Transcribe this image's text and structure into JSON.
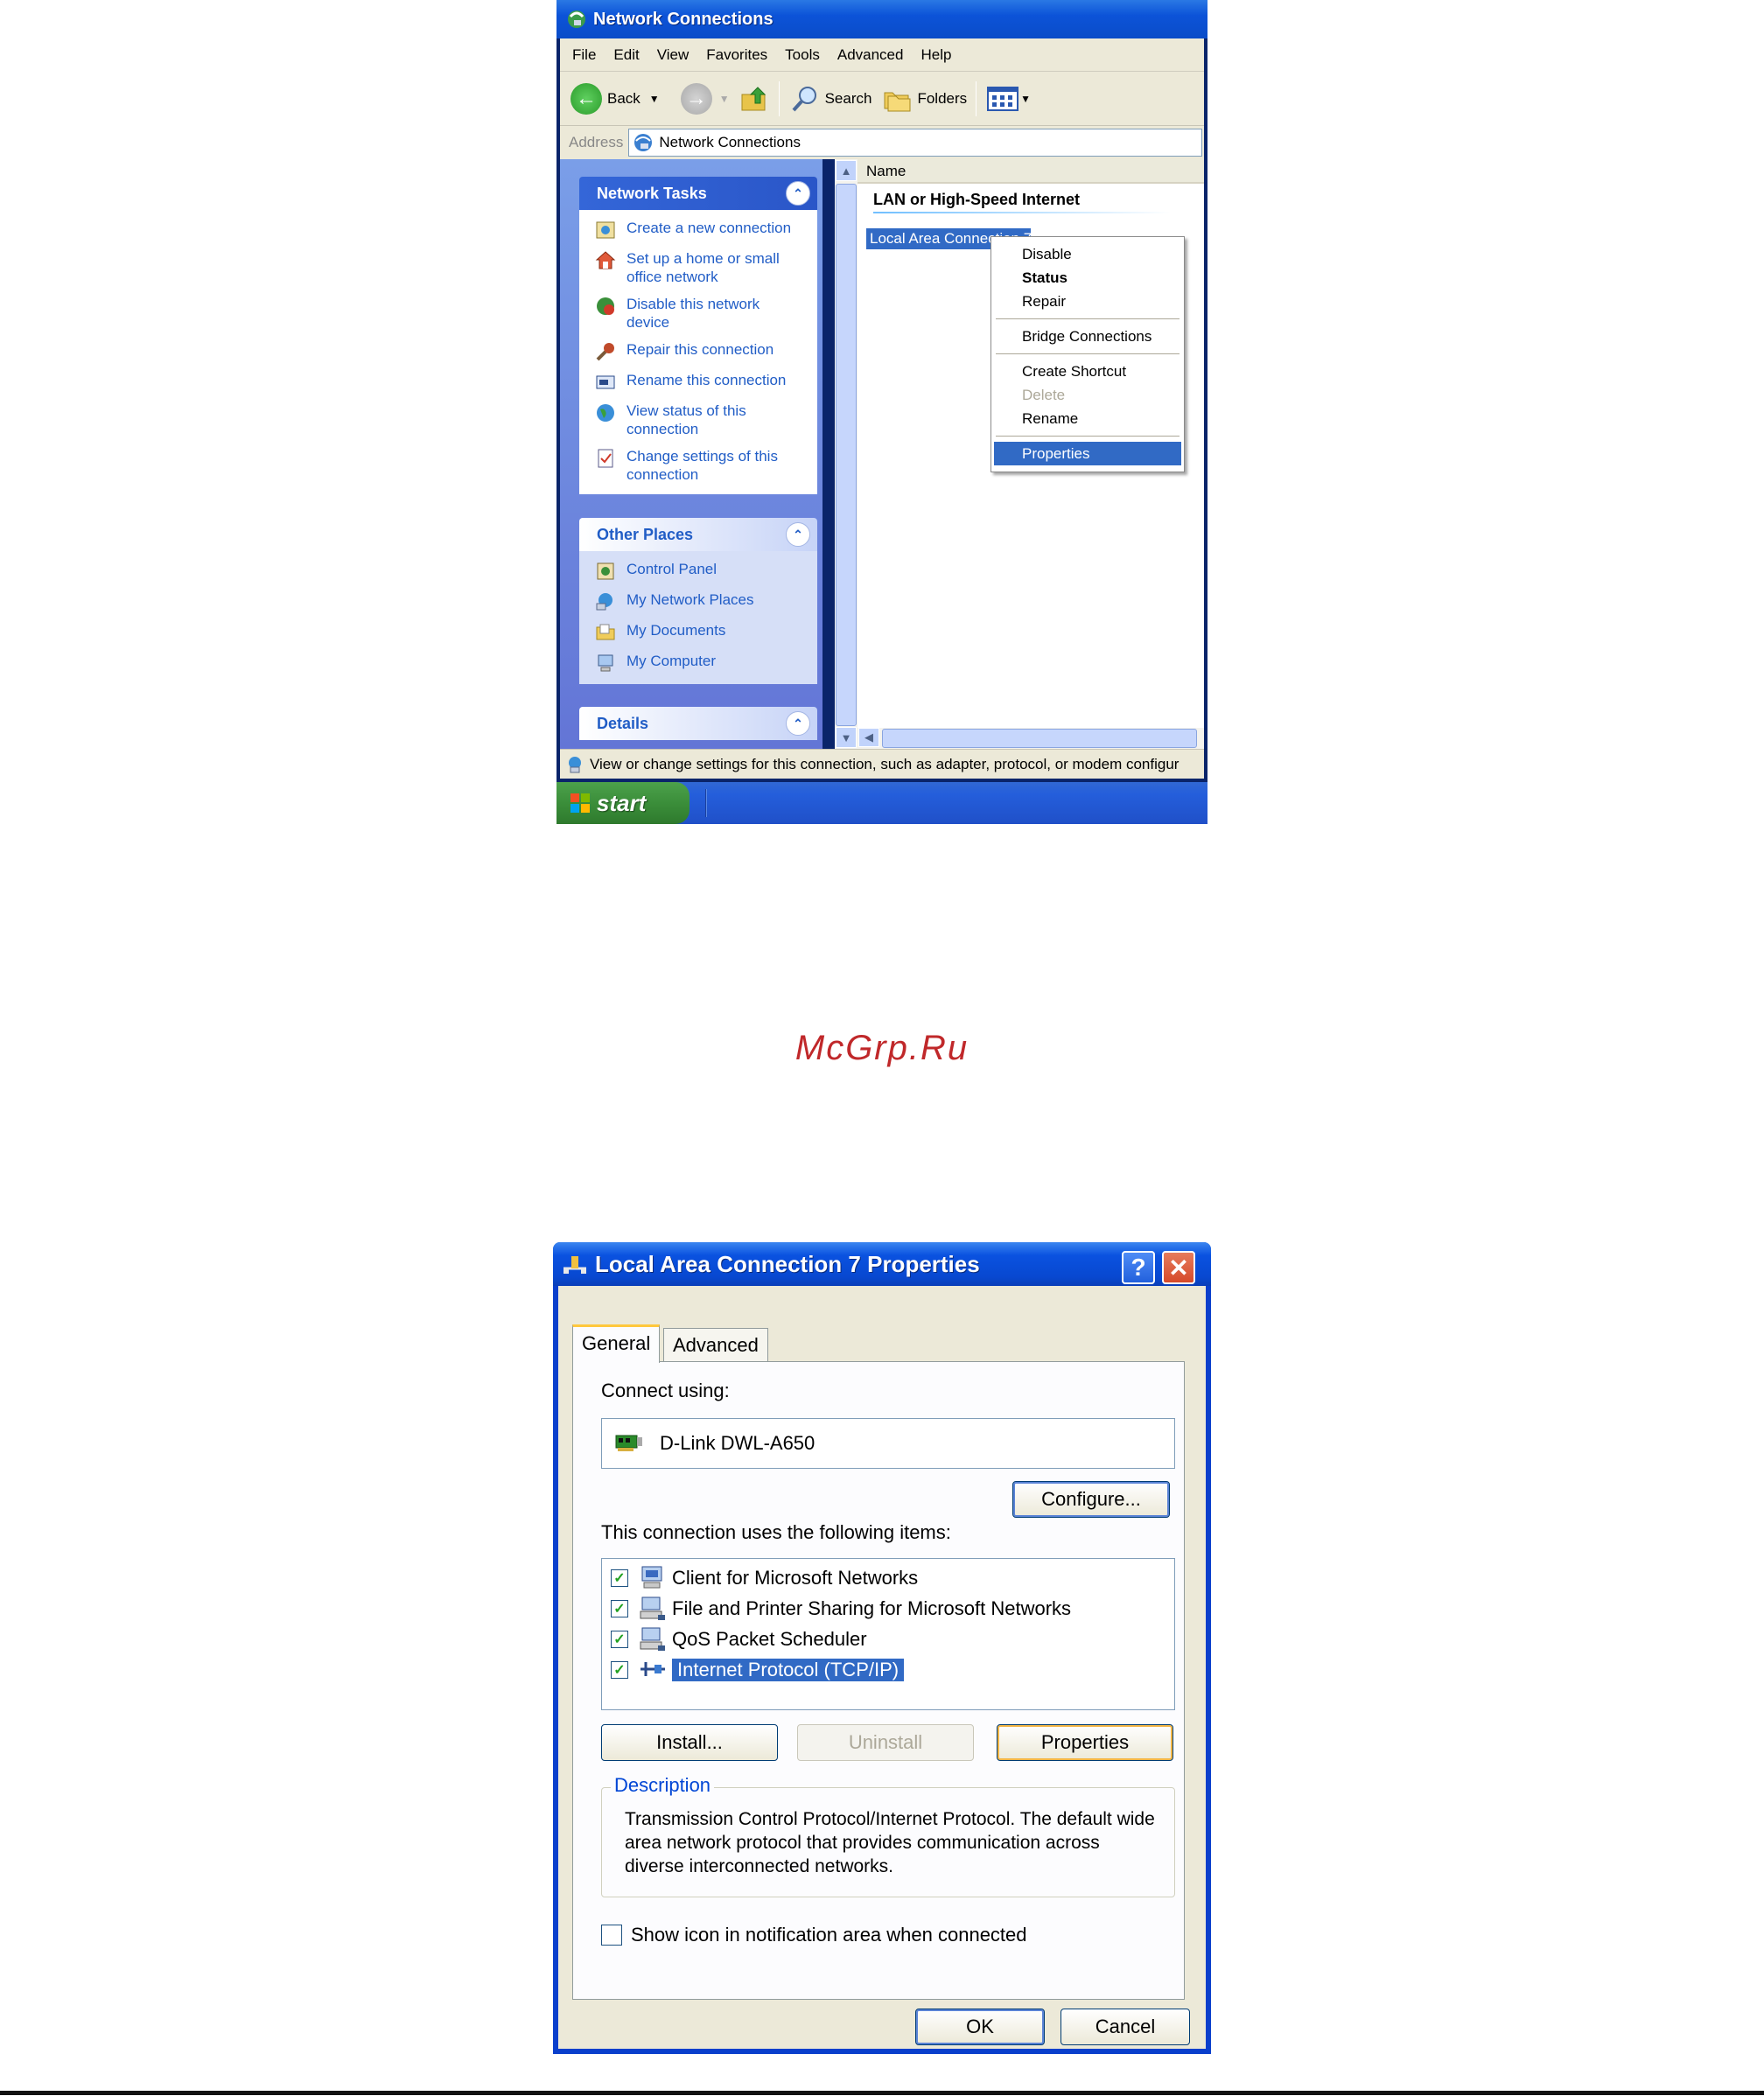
{
  "network_window": {
    "title": "Network Connections",
    "menu": [
      "File",
      "Edit",
      "View",
      "Favorites",
      "Tools",
      "Advanced",
      "Help"
    ],
    "toolbar": {
      "back": "Back",
      "search": "Search",
      "folders": "Folders"
    },
    "address": {
      "label": "Address",
      "value": "Network Connections"
    },
    "network_tasks": {
      "title": "Network Tasks",
      "items": [
        "Create a new connection",
        "Set up a home or small office network",
        "Disable this network device",
        "Repair this connection",
        "Rename this connection",
        "View status of this connection",
        "Change settings of this connection"
      ]
    },
    "other_places": {
      "title": "Other Places",
      "items": [
        "Control Panel",
        "My Network Places",
        "My Documents",
        "My Computer"
      ]
    },
    "details": {
      "title": "Details"
    },
    "list": {
      "column_name": "Name",
      "group_title": "LAN or High-Speed Internet",
      "item": "Local Area Connection 7"
    },
    "context_menu": {
      "disable": "Disable",
      "status": "Status",
      "repair": "Repair",
      "bridge": "Bridge Connections",
      "shortcut": "Create Shortcut",
      "delete": "Delete",
      "rename": "Rename",
      "properties": "Properties"
    },
    "status_text": "View or change settings for this connection, such as adapter, protocol, or modem configur",
    "start": "start"
  },
  "watermark": "McGrp.Ru",
  "dialog": {
    "title": "Local Area Connection 7 Properties",
    "tabs": {
      "general": "General",
      "advanced": "Advanced"
    },
    "connect_using": "Connect using:",
    "adapter": "D-Link DWL-A650",
    "configure": "Configure...",
    "items_label": "This connection uses the following items:",
    "items": [
      {
        "label": "Client for Microsoft Networks",
        "checked": true
      },
      {
        "label": "File and Printer Sharing for Microsoft Networks",
        "checked": true
      },
      {
        "label": "QoS Packet Scheduler",
        "checked": true
      },
      {
        "label": "Internet Protocol (TCP/IP)",
        "checked": true
      }
    ],
    "install": "Install...",
    "uninstall": "Uninstall",
    "properties": "Properties",
    "description_title": "Description",
    "description": "Transmission Control Protocol/Internet Protocol. The default wide area network protocol that provides communication across diverse interconnected networks.",
    "show_icon": "Show icon in notification area when connected",
    "ok": "OK",
    "cancel": "Cancel"
  }
}
